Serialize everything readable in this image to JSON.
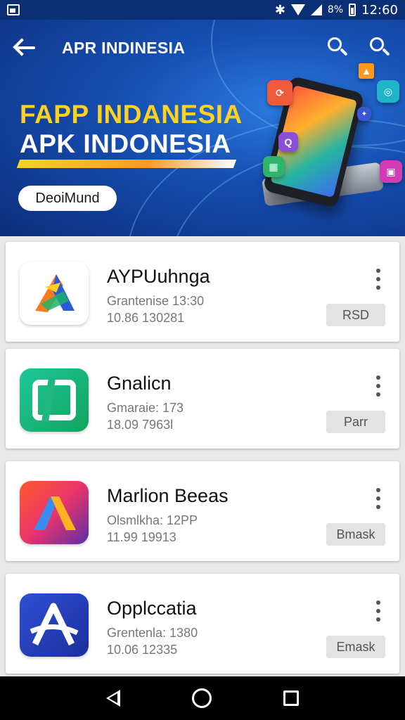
{
  "status_bar": {
    "time": "12:60",
    "battery_text": "8%"
  },
  "header": {
    "title": "APR INDINESIA",
    "banner_line1": "FAPP INDANESIA",
    "banner_line2": "APK INDONESIA",
    "banner_button": "DeoiMund"
  },
  "apps": [
    {
      "name": "AYPUuhnga",
      "meta1": "Grantenise 13:30",
      "meta2": "10.86 130281",
      "action": "RSD",
      "icon": "colorful-a-logo-icon"
    },
    {
      "name": "Gnalicn",
      "meta1": "Gmaraie: 173",
      "meta2": "18.09 7963l",
      "action": "Parr",
      "icon": "green-square-logo-icon"
    },
    {
      "name": "Marlion Beeas",
      "meta1": "Olsmlkha: 12PP",
      "meta2": "11.99 19913",
      "action": "Bmask",
      "icon": "gradient-a-logo-icon"
    },
    {
      "name": "Opplccatia",
      "meta1": "Grentenla: 1380",
      "meta2": "10.06 12335",
      "action": "Emask",
      "icon": "blue-a-logo-icon"
    }
  ],
  "colors": {
    "header_dark": "#0c2e7a",
    "header_light": "#2c7be0",
    "banner_yellow": "#ffd21f"
  }
}
